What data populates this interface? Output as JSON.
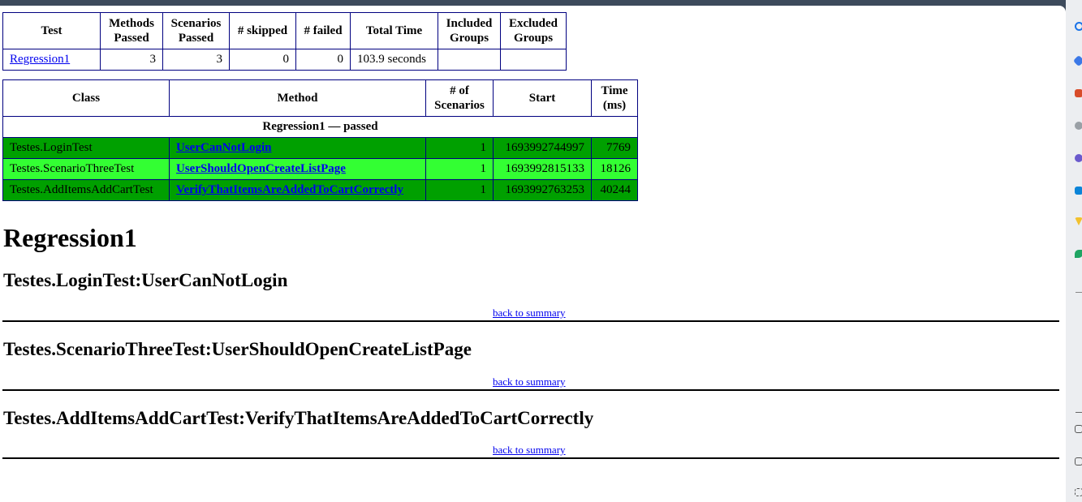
{
  "summary": {
    "headers": [
      "Test",
      "Methods Passed",
      "Scenarios Passed",
      "# skipped",
      "# failed",
      "Total Time",
      "Included Groups",
      "Excluded Groups"
    ],
    "row": {
      "test": "Regression1",
      "methods_passed": "3",
      "scenarios_passed": "3",
      "skipped": "0",
      "failed": "0",
      "total_time": "103.9 seconds",
      "included_groups": "",
      "excluded_groups": ""
    }
  },
  "details": {
    "headers": [
      "Class",
      "Method",
      "# of Scenarios",
      "Start",
      "Time (ms)"
    ],
    "group_label": "Regression1 — passed",
    "rows": [
      {
        "class": "Testes.LoginTest",
        "method": "UserCanNotLogin",
        "scenarios": "1",
        "start": "1693992744997",
        "time": "7769",
        "color": "#00a000"
      },
      {
        "class": "Testes.ScenarioThreeTest",
        "method": "UserShouldOpenCreateListPage",
        "scenarios": "1",
        "start": "1693992815133",
        "time": "18126",
        "color": "#33ff33"
      },
      {
        "class": "Testes.AddItemsAddCartTest",
        "method": "VerifyThatItemsAreAddedToCartCorrectly",
        "scenarios": "1",
        "start": "1693992763253",
        "time": "40244",
        "color": "#00a000"
      }
    ]
  },
  "suite_title": "Regression1",
  "sections": [
    {
      "title": "Testes.LoginTest:UserCanNotLogin",
      "back_link": "back to summary"
    },
    {
      "title": "Testes.ScenarioThreeTest:UserShouldOpenCreateListPage",
      "back_link": "back to summary"
    },
    {
      "title": "Testes.AddItemsAddCartTest:VerifyThatItemsAreAddedToCartCorrectly",
      "back_link": "back to summary"
    }
  ],
  "sidebar_icons": [
    "search-icon",
    "tag-icon",
    "toolbox-icon",
    "people-icon",
    "copilot-icon",
    "outlook-icon",
    "drive-icon",
    "leaf-icon",
    "add-icon",
    "screen-icon",
    "window-icon",
    "settings-icon"
  ]
}
